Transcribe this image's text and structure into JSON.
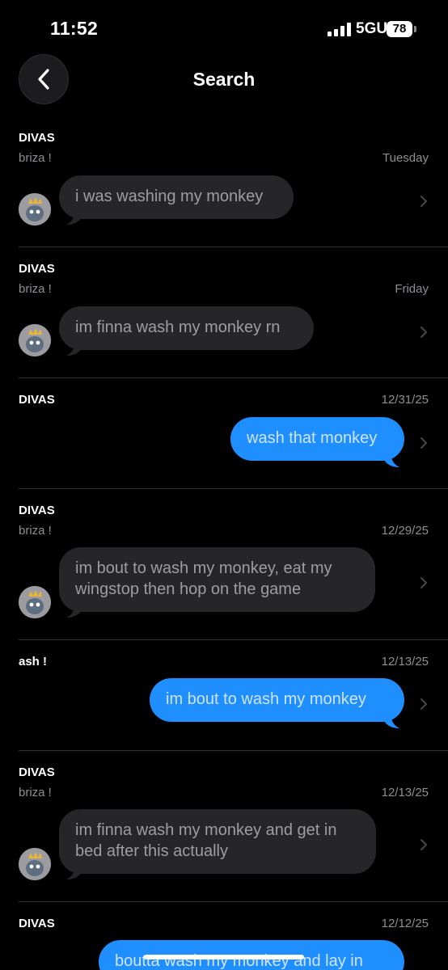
{
  "status_bar": {
    "time": "11:52",
    "network": "5GUC",
    "battery": "78"
  },
  "header": {
    "title": "Search"
  },
  "results": [
    {
      "chat": "DIVAS",
      "sender": "briza !",
      "date": "Tuesday",
      "message": "i was washing my monkey",
      "direction": "incoming"
    },
    {
      "chat": "DIVAS",
      "sender": "briza !",
      "date": "Friday",
      "message": "im finna wash my monkey rn",
      "direction": "incoming"
    },
    {
      "chat": "DIVAS",
      "sender": "",
      "date": "12/31/25",
      "message": "wash that monkey",
      "direction": "outgoing"
    },
    {
      "chat": "DIVAS",
      "sender": "briza !",
      "date": "12/29/25",
      "message": "im bout to wash my monkey, eat my wingstop then hop on the game",
      "direction": "incoming"
    },
    {
      "chat": "ash !",
      "sender": "",
      "date": "12/13/25",
      "message": "im bout to wash my monkey",
      "direction": "outgoing"
    },
    {
      "chat": "DIVAS",
      "sender": "briza !",
      "date": "12/13/25",
      "message": "im finna wash my monkey and get in bed after this actually",
      "direction": "incoming"
    },
    {
      "chat": "DIVAS",
      "sender": "",
      "date": "12/12/25",
      "message": "boutta wash my monkey and lay in",
      "direction": "outgoing"
    }
  ],
  "colors": {
    "background": "#000000",
    "incoming_bubble": "#262628",
    "outgoing_bubble": "#1f8fff",
    "secondary_text": "#8e8e93"
  }
}
